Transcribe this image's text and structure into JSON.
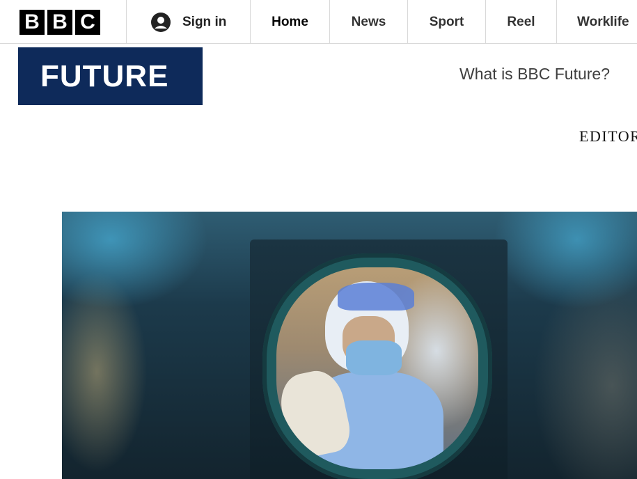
{
  "nav": {
    "logo_letters": [
      "B",
      "B",
      "C"
    ],
    "sign_in": "Sign in",
    "items": [
      "Home",
      "News",
      "Sport",
      "Reel",
      "Worklife"
    ],
    "active": "Home"
  },
  "future": {
    "logo_text": "FUTURE",
    "logo_color": "#0e2a5a",
    "what_is": "What is BBC Future?",
    "editors": "EDITOR"
  },
  "hero": {
    "icon": "hero-image-lab-worker"
  }
}
